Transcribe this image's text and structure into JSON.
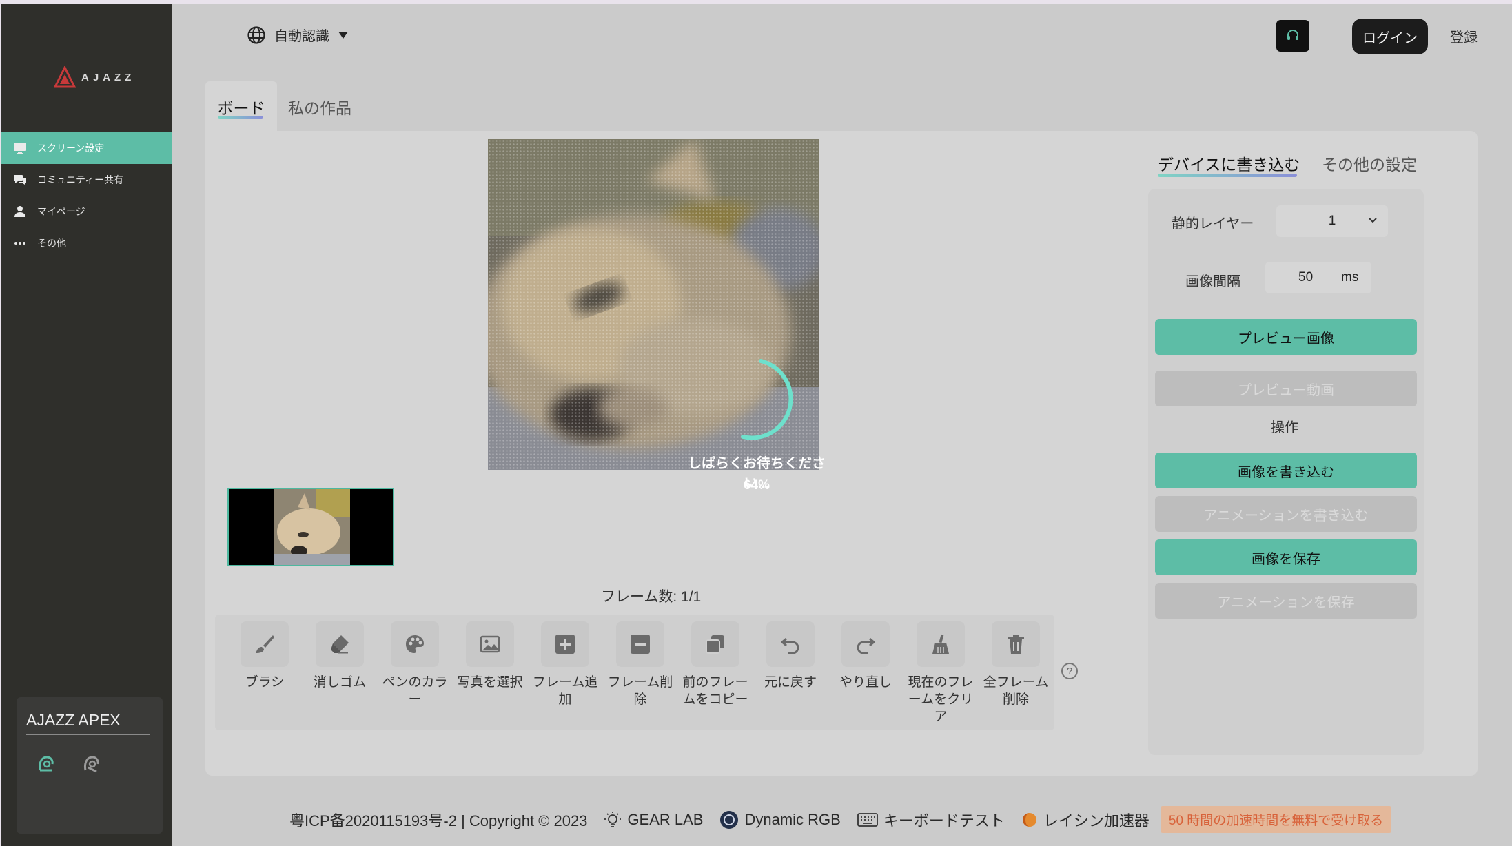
{
  "brand": {
    "logo_text": "AJAZZ"
  },
  "sidebar": {
    "items": [
      {
        "label": "スクリーン設定",
        "icon": "monitor-icon",
        "active": true
      },
      {
        "label": "コミュニティー共有",
        "icon": "chat-bubbles-icon",
        "active": false
      },
      {
        "label": "マイページ",
        "icon": "user-icon",
        "active": false
      },
      {
        "label": "その他",
        "icon": "more-dots-icon",
        "active": false
      }
    ],
    "device": {
      "name": "AJAZZ APEX"
    }
  },
  "header": {
    "language": "自動認識",
    "login": "ログイン",
    "register": "登録"
  },
  "tabs": {
    "board": "ボード",
    "my_works": "私の作品"
  },
  "canvas": {
    "loading_text": "しばらくお待ちください...",
    "progress": "64%",
    "progress_value": 0.64,
    "frame_count_label": "フレーム数: 1/1"
  },
  "tools": [
    {
      "label": "ブラシ",
      "icon": "brush-icon"
    },
    {
      "label": "消しゴム",
      "icon": "eraser-icon"
    },
    {
      "label": "ペンのカラー",
      "icon": "palette-icon"
    },
    {
      "label": "写真を選択",
      "icon": "image-icon"
    },
    {
      "label": "フレーム追加",
      "icon": "plus-square-icon"
    },
    {
      "label": "フレーム削除",
      "icon": "minus-square-icon"
    },
    {
      "label": "前のフレームをコピー",
      "icon": "copy-icon"
    },
    {
      "label": "元に戻す",
      "icon": "undo-icon"
    },
    {
      "label": "やり直し",
      "icon": "redo-icon"
    },
    {
      "label": "現在のフレームをクリア",
      "icon": "broom-icon"
    },
    {
      "label": "全フレーム削除",
      "icon": "trash-icon"
    }
  ],
  "right_panel": {
    "tab_write": "デバイスに書き込む",
    "tab_other": "その他の設定",
    "static_layer_label": "静的レイヤー",
    "static_layer_value": "1",
    "interval_label": "画像間隔",
    "interval_value": "50",
    "interval_unit": "ms",
    "preview_image": "プレビュー画像",
    "preview_video": "プレビュー動画",
    "operation_label": "操作",
    "write_image": "画像を書き込む",
    "write_animation": "アニメーションを書き込む",
    "save_image": "画像を保存",
    "save_animation": "アニメーションを保存"
  },
  "footer": {
    "copyright": "粤ICP备2020115193号-2 | Copyright © 2023",
    "gear_lab": "GEAR LAB",
    "dynamic_rgb": "Dynamic RGB",
    "keyboard_test": "キーボードテスト",
    "accelerator": "レイシン加速器",
    "promo": "50 時間の加速時間を無料で受け取る"
  },
  "colors": {
    "accent": "#5dbda6",
    "sidebar": "#2f2f2b",
    "promo_text": "#d8623a",
    "promo_bg": "#e4b89a"
  }
}
